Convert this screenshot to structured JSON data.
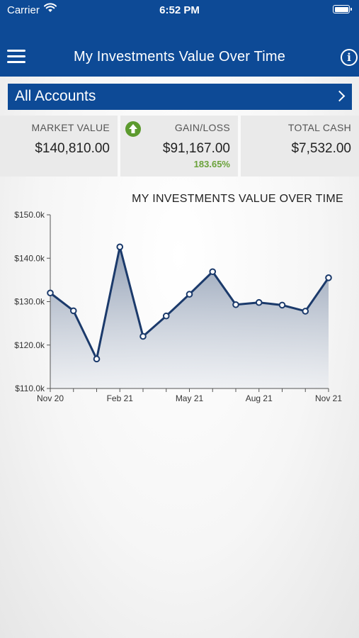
{
  "status_bar": {
    "carrier": "Carrier",
    "time": "6:52 PM"
  },
  "header": {
    "title": "My Investments Value Over Time"
  },
  "accounts": {
    "label": "All Accounts"
  },
  "summary": {
    "market_value": {
      "label": "MARKET VALUE",
      "value": "$140,810.00"
    },
    "gain_loss": {
      "label": "GAIN/LOSS",
      "value": "$91,167.00",
      "percent": "183.65%"
    },
    "total_cash": {
      "label": "TOTAL CASH",
      "value": "$7,532.00"
    }
  },
  "colors": {
    "brand": "#0d4a96",
    "gain": "#5c9a2e",
    "line": "#1b3a6b"
  },
  "chart_data": {
    "type": "area",
    "title": "MY INVESTMENTS VALUE OVER TIME",
    "x_ticks": [
      "Nov 20",
      "Feb 21",
      "May 21",
      "Aug 21",
      "Nov 21"
    ],
    "y_ticks": [
      "$110.0k",
      "$120.0k",
      "$130.0k",
      "$140.0k",
      "$150.0k"
    ],
    "ylim": [
      110,
      150
    ],
    "y_unit": "k",
    "x": [
      "Nov 20",
      "Dec 20",
      "Jan 21",
      "Feb 21",
      "Mar 21",
      "Apr 21",
      "May 21",
      "Jun 21",
      "Jul 21",
      "Aug 21",
      "Sep 21",
      "Oct 21",
      "Nov 21"
    ],
    "values": [
      132.0,
      127.9,
      116.8,
      142.6,
      122.0,
      126.7,
      131.7,
      136.9,
      129.3,
      129.8,
      129.2,
      127.8,
      135.5
    ],
    "grid": false
  }
}
